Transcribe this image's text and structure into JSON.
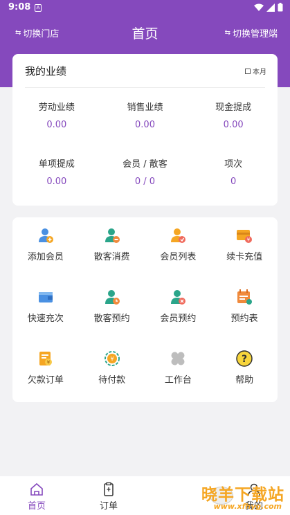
{
  "status": {
    "time": "9:08",
    "a_icon": "A"
  },
  "header": {
    "switch_store": "切换门店",
    "title": "首页",
    "switch_admin": "切换管理端"
  },
  "performance": {
    "title": "我的业绩",
    "period": "本月",
    "stats": [
      {
        "label": "劳动业绩",
        "value": "0.00"
      },
      {
        "label": "销售业绩",
        "value": "0.00"
      },
      {
        "label": "现金提成",
        "value": "0.00"
      },
      {
        "label": "单项提成",
        "value": "0.00"
      },
      {
        "label": "会员 / 散客",
        "value": "0 / 0"
      },
      {
        "label": "项次",
        "value": "0"
      }
    ]
  },
  "menu": [
    {
      "label": "添加会员",
      "icon": "add-member-icon"
    },
    {
      "label": "散客消费",
      "icon": "walkin-consume-icon"
    },
    {
      "label": "会员列表",
      "icon": "member-list-icon"
    },
    {
      "label": "续卡充值",
      "icon": "card-recharge-icon"
    },
    {
      "label": "快速充次",
      "icon": "wallet-icon"
    },
    {
      "label": "散客预约",
      "icon": "walkin-booking-icon"
    },
    {
      "label": "会员预约",
      "icon": "member-booking-icon"
    },
    {
      "label": "预约表",
      "icon": "calendar-icon"
    },
    {
      "label": "欠款订单",
      "icon": "debt-order-icon"
    },
    {
      "label": "待付款",
      "icon": "money-bag-icon"
    },
    {
      "label": "工作台",
      "icon": "workbench-icon"
    },
    {
      "label": "帮助",
      "icon": "help-icon"
    }
  ],
  "tabs": {
    "home": "首页",
    "orders": "订单",
    "mine": "我的"
  },
  "watermark": {
    "text": "晓羊下载站",
    "url": "www.xfhyg.com"
  },
  "colors": {
    "primary": "#8549bd",
    "accent_orange": "#f5a623",
    "accent_teal": "#2aa58a"
  }
}
